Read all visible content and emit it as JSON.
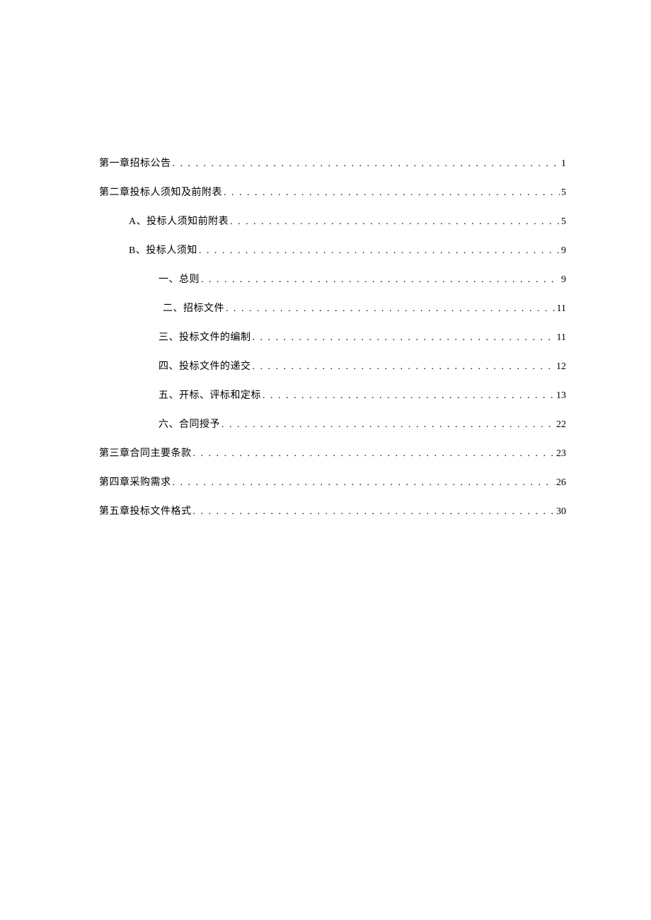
{
  "toc": [
    {
      "label": "第一章招标公告",
      "page": "1",
      "level": "level-1"
    },
    {
      "label": "第二章投标人须知及前附表",
      "page": "5",
      "level": "level-1"
    },
    {
      "label": "A、投标人须知前附表",
      "page": "5",
      "level": "level-2"
    },
    {
      "label": "B、投标人须知",
      "page": "9",
      "level": "level-2"
    },
    {
      "label": "一、总则",
      "page": "9",
      "level": "level-3"
    },
    {
      "label": "二、招标文件",
      "page": "11",
      "level": "level-3b"
    },
    {
      "label": "三、投标文件的编制",
      "page": "11",
      "level": "level-3"
    },
    {
      "label": "四、投标文件的递交",
      "page": "12",
      "level": "level-3"
    },
    {
      "label": "五、开标、评标和定标",
      "page": "13",
      "level": "level-3"
    },
    {
      "label": "六、合同授予",
      "page": "22",
      "level": "level-3"
    },
    {
      "label": "第三章合同主要条款",
      "page": "23",
      "level": "level-1"
    },
    {
      "label": "第四章采购需求",
      "page": "26",
      "level": "level-1"
    },
    {
      "label": "第五章投标文件格式",
      "page": "30",
      "level": "level-1"
    }
  ]
}
